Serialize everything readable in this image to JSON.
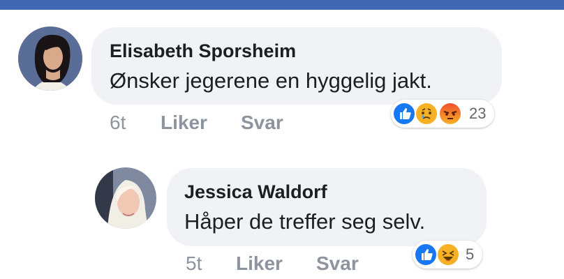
{
  "colors": {
    "header": "#4267b2",
    "bubble": "#f0f2f5",
    "like_blue": "#1877f2",
    "meta_gray": "#8d949e"
  },
  "comments": [
    {
      "author": "Elisabeth Sporsheim",
      "text": "Ønsker jegerene en hyggelig jakt.",
      "time": "6t",
      "like_label": "Liker",
      "reply_label": "Svar",
      "reactions": [
        "like-icon",
        "sad-icon",
        "angry-icon"
      ],
      "reaction_count": "23"
    },
    {
      "author": "Jessica Waldorf",
      "text": "Håper de treffer seg selv.",
      "time": "5t",
      "like_label": "Liker",
      "reply_label": "Svar",
      "reactions": [
        "like-icon",
        "haha-icon"
      ],
      "reaction_count": "5"
    }
  ]
}
